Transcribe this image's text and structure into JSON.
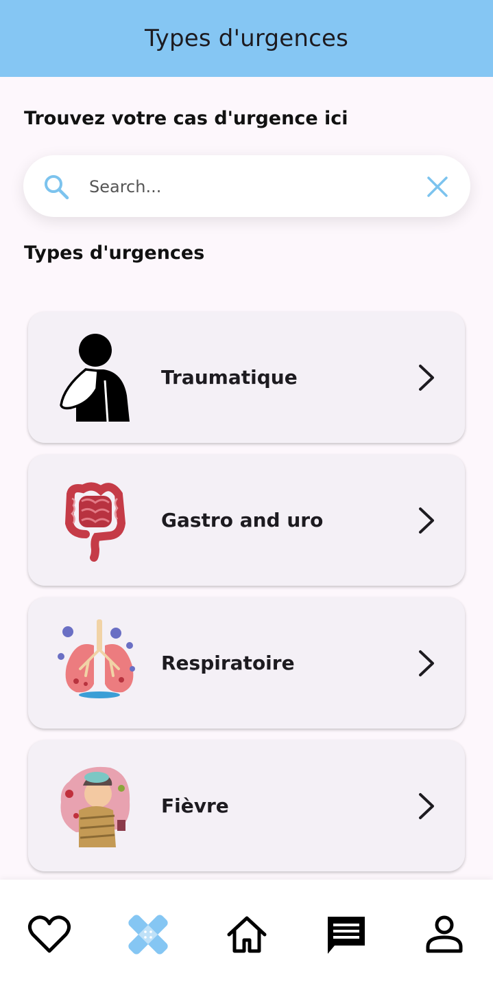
{
  "appbar": {
    "title": "Types d'urgences"
  },
  "intro": {
    "heading": "Trouvez votre cas d'urgence ici"
  },
  "search": {
    "placeholder": "Search...",
    "value": ""
  },
  "list": {
    "heading": "Types d'urgences",
    "items": [
      {
        "label": "Traumatique",
        "icon": "injured-person-sling-icon"
      },
      {
        "label": "Gastro and uro",
        "icon": "intestines-icon"
      },
      {
        "label": "Respiratoire",
        "icon": "infected-lungs-icon"
      },
      {
        "label": "Fièvre",
        "icon": "sick-person-fever-icon"
      }
    ]
  },
  "bottom_nav": {
    "items": [
      {
        "icon": "heart-icon",
        "active": false
      },
      {
        "icon": "bandage-icon",
        "active": true
      },
      {
        "icon": "home-icon",
        "active": false
      },
      {
        "icon": "chat-icon",
        "active": false
      },
      {
        "icon": "person-icon",
        "active": false
      }
    ]
  },
  "colors": {
    "appbar": "#85c6f3",
    "accent": "#7cc3ee",
    "background": "#fdf7fc",
    "card": "#f4f0f6"
  }
}
